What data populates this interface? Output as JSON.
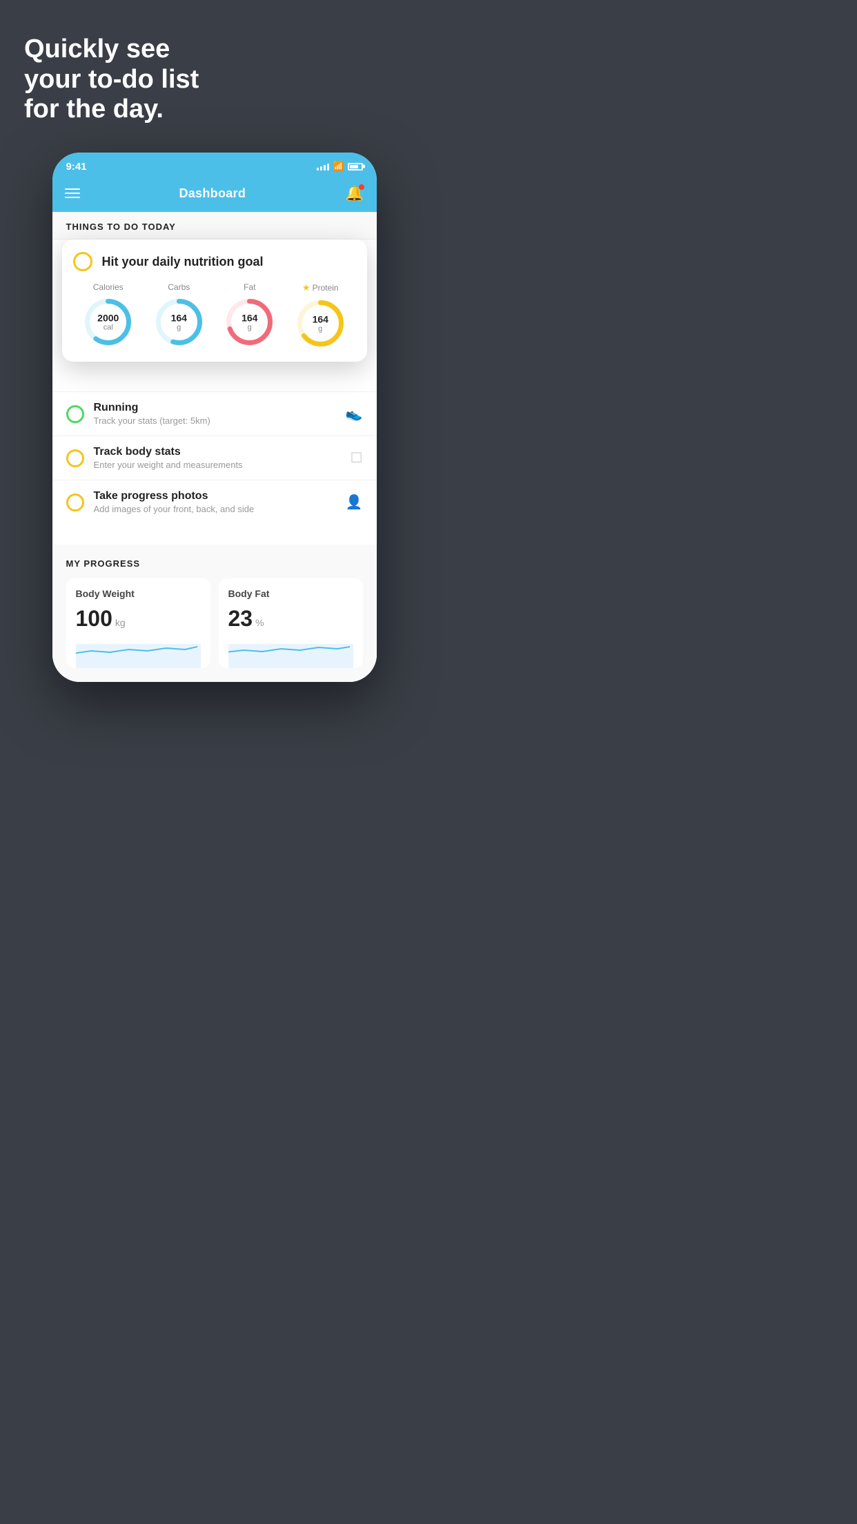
{
  "hero": {
    "line1": "Quickly see",
    "line2": "your to-do list",
    "line3": "for the day."
  },
  "statusBar": {
    "time": "9:41",
    "timeLabel": "status-time"
  },
  "navBar": {
    "title": "Dashboard"
  },
  "thingsToDoLabel": "THINGS TO DO TODAY",
  "nutritionCard": {
    "title": "Hit your daily nutrition goal",
    "calories": {
      "label": "Calories",
      "value": "2000",
      "unit": "cal",
      "color": "#4cbfe8",
      "trackColor": "#e0f5fc",
      "percent": 60
    },
    "carbs": {
      "label": "Carbs",
      "value": "164",
      "unit": "g",
      "color": "#4cbfe8",
      "trackColor": "#e0f5fc",
      "percent": 55
    },
    "fat": {
      "label": "Fat",
      "value": "164",
      "unit": "g",
      "color": "#f06b7a",
      "trackColor": "#fde8eb",
      "percent": 70
    },
    "protein": {
      "label": "Protein",
      "value": "164",
      "unit": "g",
      "color": "#f5c518",
      "trackColor": "#fdf5d9",
      "percent": 65,
      "hasStar": true
    }
  },
  "todoItems": [
    {
      "id": "running",
      "title": "Running",
      "subtitle": "Track your stats (target: 5km)",
      "circleColor": "green",
      "icon": "shoe"
    },
    {
      "id": "body-stats",
      "title": "Track body stats",
      "subtitle": "Enter your weight and measurements",
      "circleColor": "yellow",
      "icon": "scale"
    },
    {
      "id": "progress-photos",
      "title": "Take progress photos",
      "subtitle": "Add images of your front, back, and side",
      "circleColor": "yellow",
      "icon": "person"
    }
  ],
  "progressSection": {
    "label": "MY PROGRESS",
    "cards": [
      {
        "title": "Body Weight",
        "value": "100",
        "unit": "kg"
      },
      {
        "title": "Body Fat",
        "value": "23",
        "unit": "%"
      }
    ]
  }
}
